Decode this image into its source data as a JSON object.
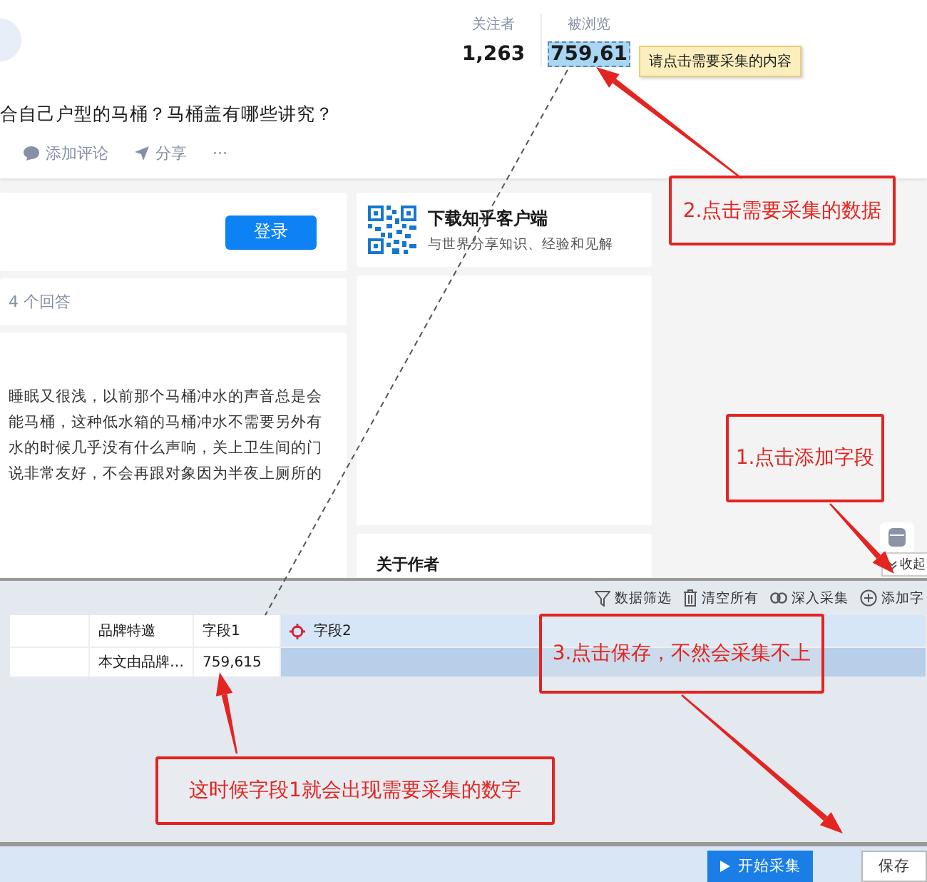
{
  "header": {
    "stats": [
      {
        "label": "关注者",
        "value": "1,263",
        "selected": false
      },
      {
        "label": "被浏览",
        "value": "759,61",
        "selected": true
      }
    ],
    "tooltip": "请点击需要采集的内容",
    "title": "合自己户型的马桶？马桶盖有哪些讲究？",
    "actions": [
      {
        "kind": "comment",
        "label": "添加评论"
      },
      {
        "kind": "share",
        "label": "分享"
      },
      {
        "kind": "more",
        "label": "···"
      }
    ]
  },
  "login_card": {
    "button": "登录"
  },
  "answers_card": {
    "count": "4 个回答"
  },
  "article": {
    "lines": [
      "睡眠又很浅，以前那个马桶冲水的声音总是会",
      "能马桶，这种低水箱的马桶冲水不需要另外有",
      "水的时候几乎没有什么声响，关上卫生间的门",
      "说非常友好，不会再跟对象因为半夜上厕所的"
    ]
  },
  "app_card": {
    "title": "下载知乎客户端",
    "subtitle": "与世界分享知识、经验和见解"
  },
  "author_card": {
    "title": "关于作者"
  },
  "side": {
    "collapse": "收起"
  },
  "panel": {
    "toolbar": [
      {
        "kind": "filter",
        "label": "数据筛选"
      },
      {
        "kind": "clear",
        "label": "清空所有"
      },
      {
        "kind": "deep",
        "label": "深入采集"
      },
      {
        "kind": "add",
        "label": "添加字"
      }
    ],
    "columns": [
      {
        "label": "品牌特邀",
        "selected": false
      },
      {
        "label": "字段1",
        "selected": false
      },
      {
        "label": "字段2",
        "selected": true
      }
    ],
    "rows": [
      [
        "本文由品牌…",
        "759,615"
      ]
    ]
  },
  "footer": {
    "buttons": [
      {
        "kind": "primary",
        "label": "开始采集"
      },
      {
        "kind": "plain",
        "label": "保存"
      }
    ]
  },
  "annotations": [
    {
      "text": "2.点击需要采集的数据"
    },
    {
      "text": "1.点击添加字段"
    },
    {
      "text": "3.点击保存，不然会采集不上"
    },
    {
      "text": "这时候字段1就会出现需要采集的数字"
    }
  ]
}
